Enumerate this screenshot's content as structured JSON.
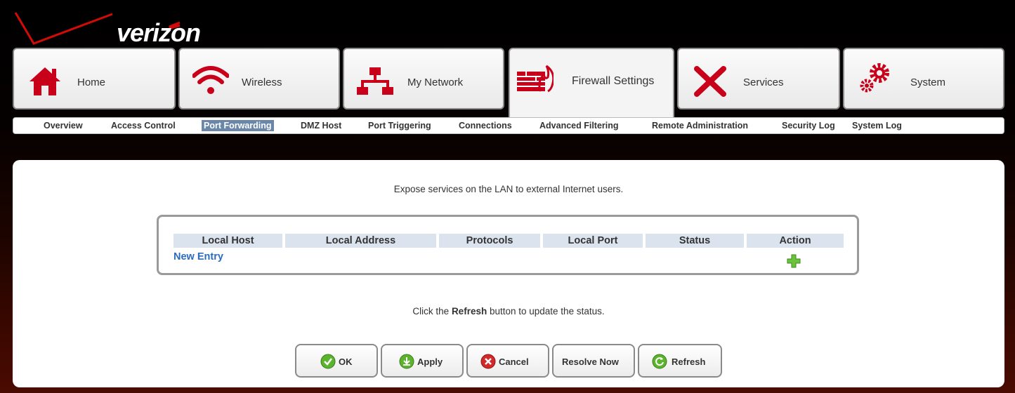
{
  "brand": {
    "name": "verizon"
  },
  "tabs": [
    {
      "label": "Home",
      "icon": "home-icon"
    },
    {
      "label": "Wireless",
      "icon": "wireless-icon"
    },
    {
      "label": "My Network",
      "icon": "network-icon"
    },
    {
      "label": "Firewall Settings",
      "icon": "firewall-icon",
      "active": true
    },
    {
      "label": "Services",
      "icon": "tools-icon"
    },
    {
      "label": "System",
      "icon": "gears-icon"
    }
  ],
  "subnav": [
    {
      "label": "Overview"
    },
    {
      "label": "Access Control"
    },
    {
      "label": "Port Forwarding",
      "active": true
    },
    {
      "label": "DMZ Host"
    },
    {
      "label": "Port Triggering"
    },
    {
      "label": "Connections"
    },
    {
      "label": "Advanced Filtering"
    },
    {
      "label": "Remote Administration"
    },
    {
      "label": "Security Log"
    },
    {
      "label": "System Log"
    }
  ],
  "main": {
    "intro": "Expose services on the LAN to external Internet users.",
    "table": {
      "columns": [
        "Local Host",
        "Local Address",
        "Protocols",
        "Local Port",
        "Status",
        "Action"
      ],
      "new_entry": "New Entry",
      "add_icon": "plus-icon"
    },
    "note": {
      "before": "Click the ",
      "bold": "Refresh",
      "after": " button to update the status."
    },
    "buttons": [
      {
        "label": "OK",
        "icon": "check-icon"
      },
      {
        "label": "Apply",
        "icon": "apply-icon"
      },
      {
        "label": "Cancel",
        "icon": "cancel-icon"
      },
      {
        "label": "Resolve Now",
        "icon": ""
      },
      {
        "label": "Refresh",
        "icon": "refresh-icon"
      }
    ]
  },
  "colors": {
    "accent_red": "#cc0000",
    "active_subnav": "#6a86a8",
    "link_blue": "#2a6cbd",
    "header_blue": "#dbe4ee"
  }
}
